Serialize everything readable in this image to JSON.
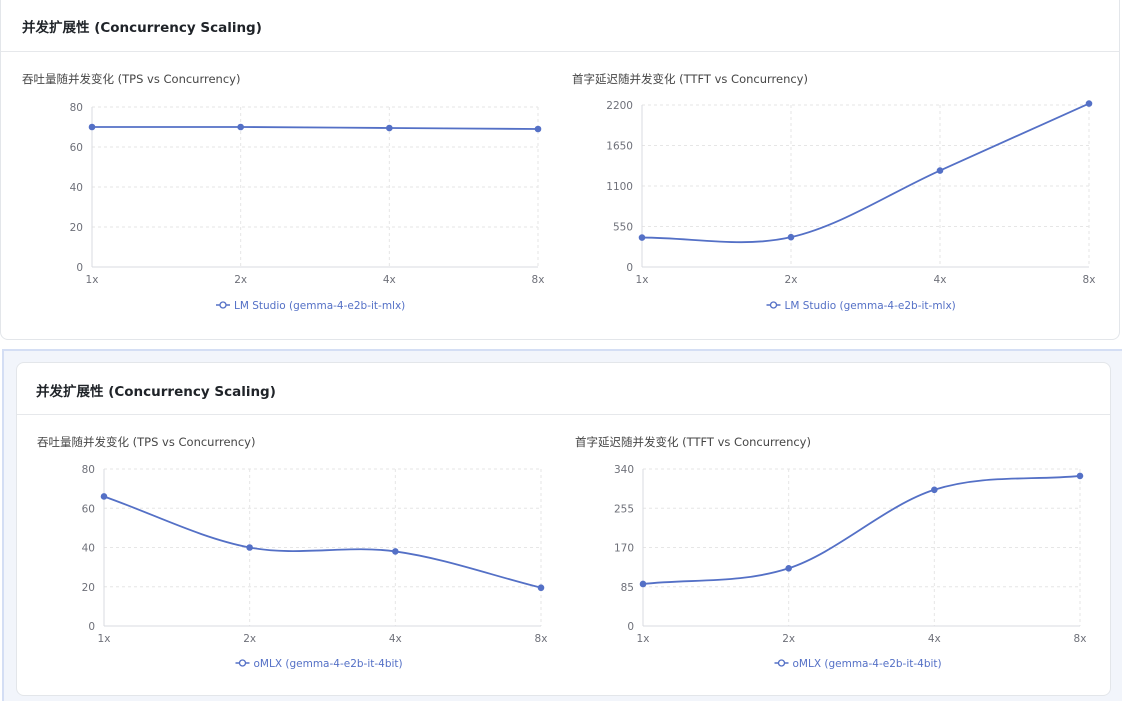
{
  "theme": {
    "line_color": "#5470c6",
    "grid_color": "#e6e6e6",
    "axis_color": "#d9dbe0",
    "label_color": "#6e7079"
  },
  "panels": [
    {
      "title": "并发扩展性 (Concurrency Scaling)"
    },
    {
      "title": "并发扩展性 (Concurrency Scaling)"
    }
  ],
  "chart_data": [
    {
      "type": "line",
      "title": "吞吐量随并发变化 (TPS vs Concurrency)",
      "categories": [
        "1x",
        "2x",
        "4x",
        "8x"
      ],
      "series": [
        {
          "name": "LM Studio (gemma-4-e2b-it-mlx)",
          "values": [
            70,
            70,
            69.5,
            69
          ]
        }
      ],
      "yticks": [
        0,
        20,
        40,
        60,
        80
      ],
      "ylim": [
        0,
        80
      ],
      "grid": true,
      "legend": "bottom-center"
    },
    {
      "type": "line",
      "title": "首字延迟随并发变化 (TTFT vs Concurrency)",
      "categories": [
        "1x",
        "2x",
        "4x",
        "8x"
      ],
      "series": [
        {
          "name": "LM Studio (gemma-4-e2b-it-mlx)",
          "values": [
            400,
            405,
            1310,
            2220
          ]
        }
      ],
      "yticks": [
        0,
        550,
        1100,
        1650,
        2200
      ],
      "ylim": [
        0,
        2200
      ],
      "grid": true,
      "legend": "bottom-center"
    },
    {
      "type": "line",
      "title": "吞吐量随并发变化 (TPS vs Concurrency)",
      "categories": [
        "1x",
        "2x",
        "4x",
        "8x"
      ],
      "series": [
        {
          "name": "oMLX (gemma-4-e2b-it-4bit)",
          "values": [
            66,
            40,
            38,
            19.5
          ]
        }
      ],
      "yticks": [
        0,
        20,
        40,
        60,
        80
      ],
      "ylim": [
        0,
        80
      ],
      "grid": true,
      "legend": "bottom-center"
    },
    {
      "type": "line",
      "title": "首字延迟随并发变化 (TTFT vs Concurrency)",
      "categories": [
        "1x",
        "2x",
        "4x",
        "8x"
      ],
      "series": [
        {
          "name": "oMLX (gemma-4-e2b-it-4bit)",
          "values": [
            91,
            125,
            295,
            325
          ]
        }
      ],
      "yticks": [
        0,
        85,
        170,
        255,
        340
      ],
      "ylim": [
        0,
        340
      ],
      "grid": true,
      "legend": "bottom-center"
    }
  ]
}
